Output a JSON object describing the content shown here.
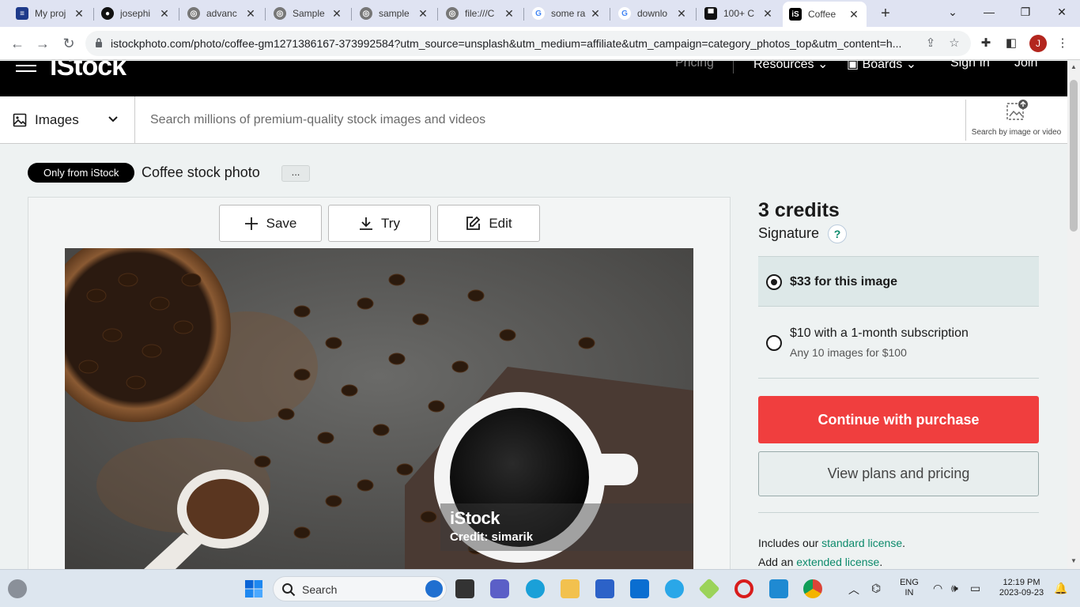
{
  "browser": {
    "tabs": [
      {
        "title": "My proj",
        "icon": "kanban-icon",
        "color": "#1e3a8a"
      },
      {
        "title": "josephi",
        "icon": "github-icon",
        "color": "#111111"
      },
      {
        "title": "advanc",
        "icon": "globe-icon",
        "color": "#555555"
      },
      {
        "title": "Sample",
        "icon": "globe-icon",
        "color": "#555555"
      },
      {
        "title": "sample",
        "icon": "globe-icon",
        "color": "#555555"
      },
      {
        "title": "file:///C",
        "icon": "globe-icon",
        "color": "#555555"
      },
      {
        "title": "some ra",
        "icon": "google-icon",
        "color": "#4285f4"
      },
      {
        "title": "downlo",
        "icon": "google-icon",
        "color": "#4285f4"
      },
      {
        "title": "100+ C",
        "icon": "unsplash-icon",
        "color": "#111111"
      },
      {
        "title": "Coffee",
        "icon": "istock-icon",
        "color": "#000000"
      }
    ],
    "url": "istockphoto.com/photo/coffee-gm1271386167-373992584?utm_source=unsplash&utm_medium=affiliate&utm_campaign=category_photos_top&utm_content=h...",
    "profile_initial": "J"
  },
  "site": {
    "logo": "iStock",
    "nav": {
      "pricing": "Pricing",
      "resources": "Resources",
      "boards": "Boards",
      "signin": "Sign In",
      "join": "Join"
    }
  },
  "search": {
    "type": "Images",
    "placeholder": "Search millions of premium-quality stock images and videos",
    "search_by_image": "Search by image or video"
  },
  "page": {
    "badge": "Only from iStock",
    "title": "Coffee stock photo",
    "more": "..."
  },
  "actions": {
    "save": "Save",
    "try": "Try",
    "edit": "Edit"
  },
  "watermark": {
    "logo": "iStock",
    "credit": "Credit: simarik"
  },
  "purchase": {
    "credits": "3 credits",
    "tier": "Signature",
    "help": "?",
    "option1": "$33 for this image",
    "option2": "$10 with a 1-month subscription",
    "option2_sub": "Any 10 images for $100",
    "selected_option": 1,
    "cta": "Continue with purchase",
    "plans": "View plans and pricing",
    "license1_prefix": "Includes our",
    "license1_link": "standard license",
    "license2_prefix": "Add an",
    "license2_link": "extended license",
    "accent": "#f03e3e",
    "link_color": "#0c8a6b"
  },
  "taskbar": {
    "search": "Search",
    "lang1": "ENG",
    "lang2": "IN",
    "time": "12:19 PM",
    "date": "2023-09-23"
  }
}
